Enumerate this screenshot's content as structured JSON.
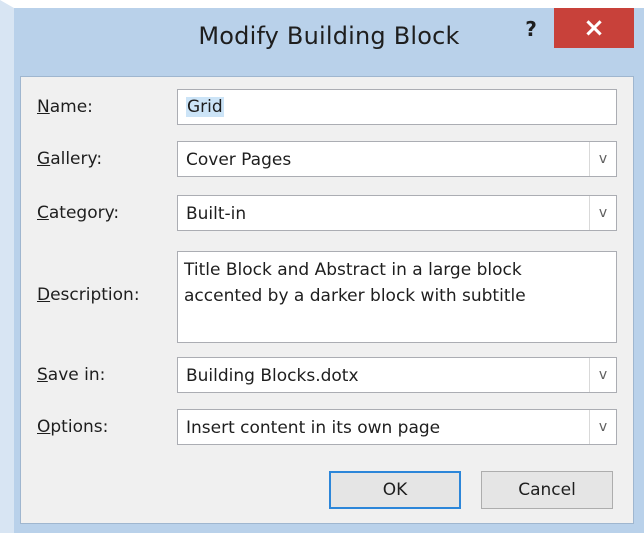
{
  "dialog": {
    "title": "Modify Building Block",
    "help_glyph": "?",
    "close_glyph": "×"
  },
  "form": {
    "name": {
      "label": "Name:",
      "mnemonic": "N",
      "rest": "ame:",
      "value": "Grid"
    },
    "gallery": {
      "label": "Gallery:",
      "mnemonic": "G",
      "rest": "allery:",
      "value": "Cover Pages"
    },
    "category": {
      "label": "Category:",
      "mnemonic": "C",
      "rest": "ategory:",
      "value": "Built-in"
    },
    "description": {
      "label": "Description:",
      "mnemonic": "D",
      "rest": "escription:",
      "lines": [
        "Title Block and Abstract in a large block",
        "accented by a darker block with subtitle"
      ]
    },
    "save_in": {
      "label": "Save in:",
      "mnemonic": "S",
      "rest": "ave in:",
      "value": "Building Blocks.dotx"
    },
    "options": {
      "label": "Options:",
      "mnemonic": "O",
      "rest": "ptions:",
      "value": "Insert content in its own page"
    }
  },
  "buttons": {
    "ok": "OK",
    "cancel": "Cancel"
  },
  "dropdown_glyph": "v"
}
